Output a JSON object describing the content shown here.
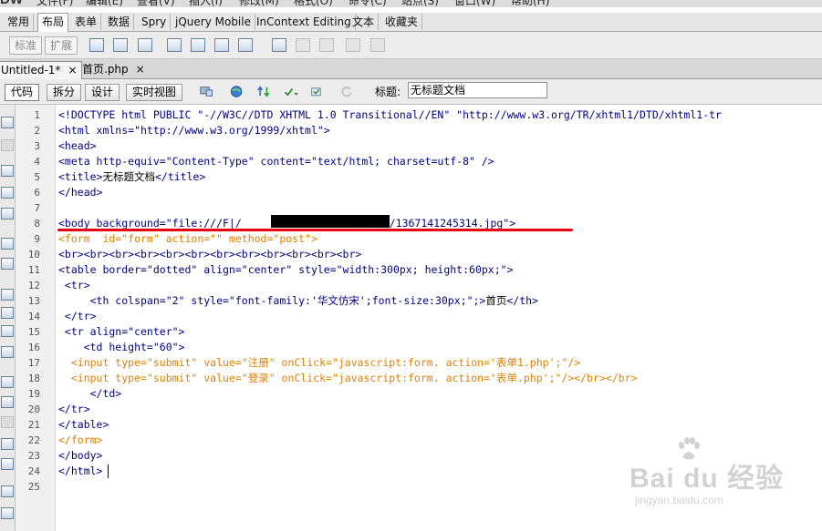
{
  "menubar": {
    "logo": "DW",
    "items": [
      "文件(F)",
      "编辑(E)",
      "查看(V)",
      "插入(I)",
      "修改(M)",
      "格式(O)",
      "命令(C)",
      "站点(S)",
      "窗口(W)",
      "帮助(H)"
    ]
  },
  "insert_tabs": [
    "常用",
    "布局",
    "表单",
    "数据",
    "Spry",
    "jQuery Mobile",
    "InContext Editing",
    "文本",
    "收藏夹"
  ],
  "insert_active_tab": "布局",
  "insert_toolbar": {
    "standard_label": "标准",
    "expand_label": "扩展"
  },
  "document_tabs": [
    {
      "label": "Untitled-1*",
      "close": "×"
    },
    {
      "label": "首页.php",
      "close": "×"
    }
  ],
  "document_toolbar": {
    "views": [
      "代码",
      "拆分",
      "设计",
      "实时视图"
    ],
    "title_label": "标题:",
    "title_value": "无标题文档"
  },
  "line_numbers": [
    "1",
    "2",
    "3",
    "4",
    "5",
    "6",
    "7",
    "8",
    "9",
    "10",
    "11",
    "12",
    "13",
    "14",
    "15",
    "16",
    "17",
    "18",
    "19",
    "20",
    "21",
    "22",
    "23",
    "24",
    "25"
  ],
  "code": {
    "l1": "<!DOCTYPE html PUBLIC \"-//W3C//DTD XHTML 1.0 Transitional//EN\" \"http://www.w3.org/TR/xhtml1/DTD/xhtml1-tr",
    "l2": "<html xmlns=\"http://www.w3.org/1999/xhtml\">",
    "l3": "<head>",
    "l4": "<meta http-equiv=\"Content-Type\" content=\"text/html; charset=utf-8\" />",
    "l5a": "<title>",
    "l5b": "无标题文档",
    "l5c": "</title>",
    "l6": "</head>",
    "l7": "",
    "l8a": "<body background=\"file:///F|/",
    "l8b": "/表格/1367141245314.jpg\">",
    "l9": "<form  id=\"form\" action=\"\" method=\"post\">",
    "l10": "<br><br><br><br><br><br><br><br><br><br><br><br>",
    "l11": "<table border=\"dotted\" align=\"center\" style=\"width:300px; height:60px;\">",
    "l12": " <tr>",
    "l13a": "     <th colspan=\"2\" style=\"font-family:'华文仿宋';font-size:30px;\";>",
    "l13b": "首页",
    "l13c": "</th>",
    "l14": " </tr>",
    "l15": " <tr align=\"center\">",
    "l16": "    <td height=\"60\">",
    "l17": "  <input type=\"submit\" value=\"注册\" onClick=\"javascript:form. action='表单1.php';\"/>",
    "l18": "  <input type=\"submit\" value=\"登录\" onClick=\"javascript:form. action='表单.php';\"/></br></br>",
    "l19": "     </td>",
    "l20": "</tr>",
    "l21": "</table>",
    "l22": "</form>",
    "l23": "</body>",
    "l24": "</html>",
    "l25": ""
  },
  "watermark": {
    "brand": "Bai du 经验",
    "url": "jingyan.baidu.com"
  },
  "colors": {
    "annotation_underline": "#e60012",
    "tag_color": "#000080",
    "form_tag_color": "#e08000"
  }
}
